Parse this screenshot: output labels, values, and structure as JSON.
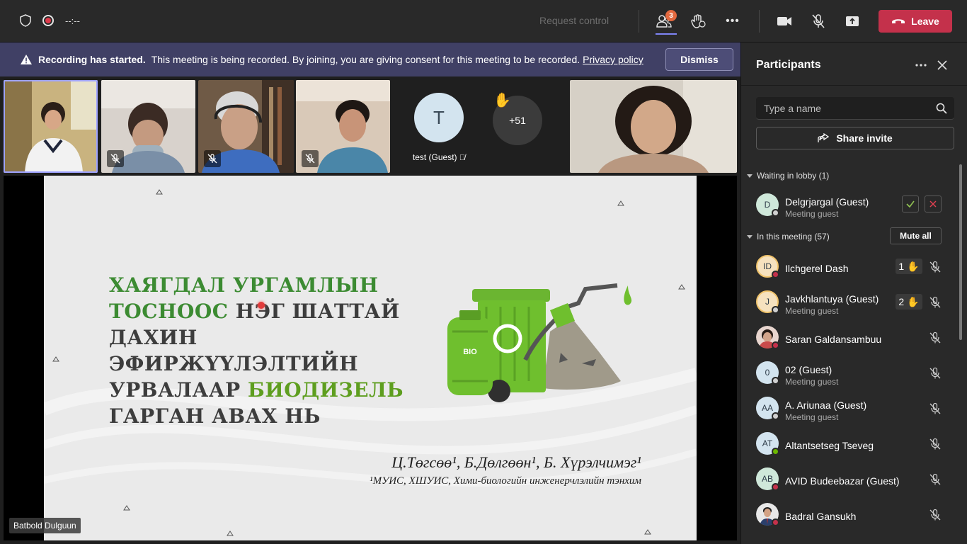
{
  "topbar": {
    "timer": "--:--",
    "request_control": "Request control",
    "people_count": "3",
    "more_label": "•••",
    "leave_label": "Leave"
  },
  "banner": {
    "bold": "Recording has started.",
    "text": "This meeting is being recorded. By joining, you are giving consent for this meeting to be recorded.",
    "link": "Privacy policy",
    "dismiss": "Dismiss"
  },
  "stage": {
    "guest_initial": "T",
    "guest_name": "test (Guest)",
    "more_count": "+51",
    "presenter": "Batbold Dulguun"
  },
  "slide": {
    "title_line1": "ХАЯГДАЛ УРГАМЛЫН",
    "title_line2_green": "ТОСНООС",
    "title_line2_rest": " НЭГ ШАТТАЙ",
    "title_line3": "ДАХИН ЭФИРЖҮҮЛЭЛТИЙН",
    "title_line4_start": "УРВАЛААР ",
    "title_line4_green": "БИОДИЗЕЛЬ",
    "title_line5": "ГАРГАН АВАХ НЬ",
    "authors": "Ц.Төгсөө¹, Б.Дөлгөөн¹, Б. Хүрэлчимэг¹",
    "affiliation": "¹МУИС, ХШУИС, Хими-биологийн инженерчлэлийн тэнхим",
    "can_label": "BIO"
  },
  "panel": {
    "title": "Participants",
    "search_placeholder": "Type a name",
    "share_invite": "Share invite",
    "lobby_header": "Waiting in lobby (1)",
    "meeting_header": "In this meeting (57)",
    "mute_all": "Mute all",
    "lobby": [
      {
        "initials": "D",
        "name": "Delgrjargal (Guest)",
        "sub": "Meeting guest"
      }
    ],
    "participants": [
      {
        "initials": "ID",
        "name": "Ilchgerel Dash",
        "sub": "",
        "hand": "1"
      },
      {
        "initials": "J",
        "name": "Javkhlantuya (Guest)",
        "sub": "Meeting guest",
        "hand": "2"
      },
      {
        "initials": "",
        "name": "Saran Galdansambuu",
        "sub": ""
      },
      {
        "initials": "0",
        "name": "02 (Guest)",
        "sub": "Meeting guest"
      },
      {
        "initials": "AA",
        "name": "A. Ariunaa (Guest)",
        "sub": "Meeting guest"
      },
      {
        "initials": "AT",
        "name": "Altantsetseg Tseveg",
        "sub": ""
      },
      {
        "initials": "AB",
        "name": "AVID Budeebazar (Guest)",
        "sub": ""
      },
      {
        "initials": "",
        "name": "Badral Gansukh",
        "sub": ""
      }
    ]
  },
  "colors": {
    "accent": "#7f85f5",
    "leave": "#c4314b",
    "banner": "#404065",
    "slide_green": "#3c8b32"
  }
}
